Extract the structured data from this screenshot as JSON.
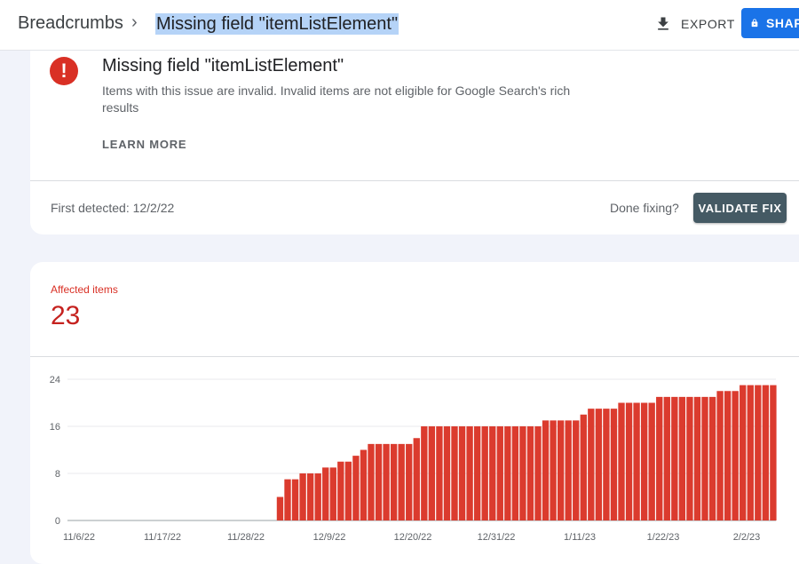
{
  "header": {
    "breadcrumb_root": "Breadcrumbs",
    "breadcrumb_sep": "›",
    "breadcrumb_current": "Missing field \"itemListElement\"",
    "export_label": "EXPORT",
    "share_label": "SHARE",
    "share_color": "#1a73e8"
  },
  "issue": {
    "icon": "!",
    "title": "Missing field \"itemListElement\"",
    "description": "Items with this issue are invalid. Invalid items are not eligible for Google Search's rich results",
    "learn_more": "LEARN MORE",
    "first_detected": "First detected: 12/2/22",
    "done_fixing": "Done fixing?",
    "validate_fix": "VALIDATE FIX",
    "error_color": "#d93025"
  },
  "affected": {
    "label": "Affected items",
    "count": "23"
  },
  "chart_data": {
    "type": "bar",
    "color": "#db3b2e",
    "ylim": [
      0,
      24
    ],
    "yticks": [
      "24",
      "16",
      "8",
      "0"
    ],
    "xticks": [
      "11/6/22",
      "11/17/22",
      "11/28/22",
      "12/9/22",
      "12/20/22",
      "12/31/22",
      "1/11/23",
      "1/22/23",
      "2/2/23"
    ],
    "start_date": "2022-12-02",
    "values": [
      4,
      7,
      7,
      8,
      8,
      8,
      9,
      9,
      10,
      10,
      11,
      12,
      13,
      13,
      13,
      13,
      13,
      13,
      14,
      16,
      16,
      16,
      16,
      16,
      16,
      16,
      16,
      16,
      16,
      16,
      16,
      16,
      16,
      16,
      16,
      17,
      17,
      17,
      17,
      17,
      18,
      19,
      19,
      19,
      19,
      20,
      20,
      20,
      20,
      20,
      21,
      21,
      21,
      21,
      21,
      21,
      21,
      21,
      22,
      22,
      22,
      23,
      23,
      23,
      23,
      23
    ]
  }
}
